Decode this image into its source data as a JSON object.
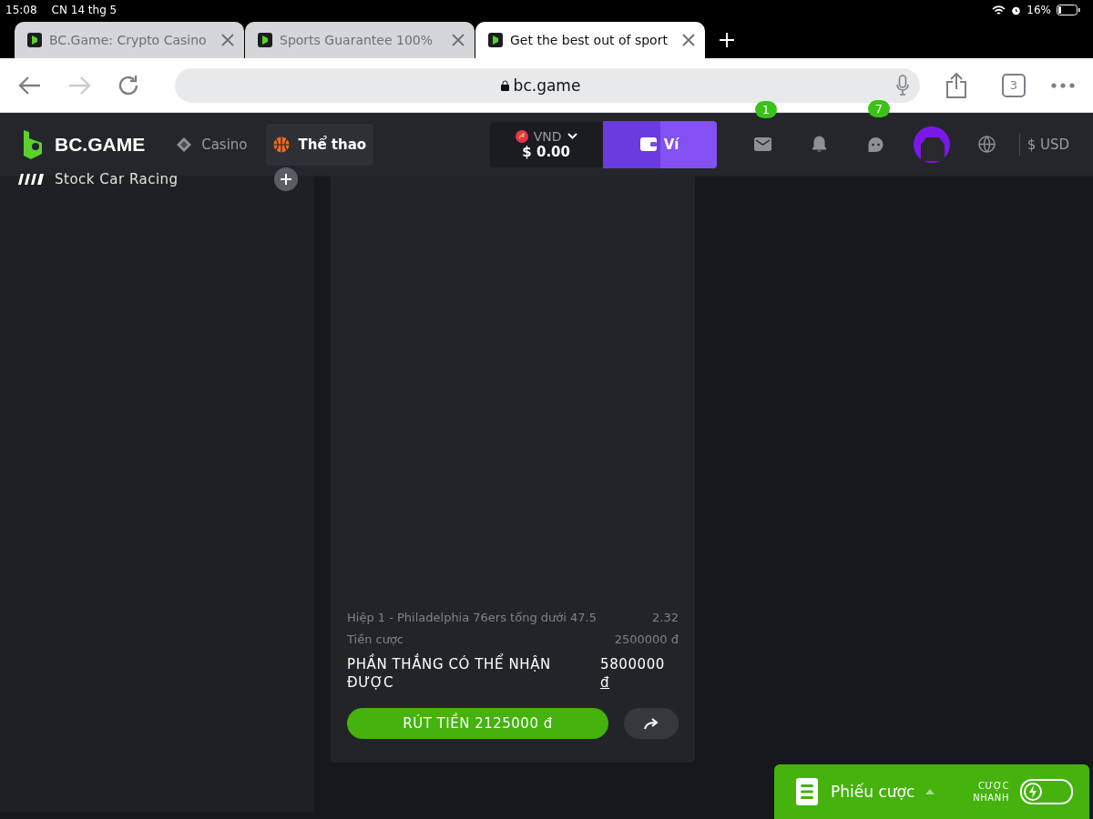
{
  "status_bar": {
    "time": "15:08",
    "date": "CN 14 thg 5",
    "battery": "16%"
  },
  "browser": {
    "tabs": [
      {
        "title": "BC.Game: Crypto Casino",
        "selected": false
      },
      {
        "title": "Sports Guarantee 100%",
        "selected": false
      },
      {
        "title": "Get the best out of sport",
        "selected": true
      }
    ],
    "url": "bc.game",
    "tab_count": "3"
  },
  "header": {
    "logo": "BC.GAME",
    "nav": [
      {
        "label": "Casino",
        "kind": "casino",
        "selected": false
      },
      {
        "label": "Thể thao",
        "kind": "sports",
        "selected": true
      }
    ],
    "balance": {
      "currency": "VND",
      "amount": "$ 0.00"
    },
    "wallet_button": "Ví",
    "icons": [
      {
        "kind": "mail",
        "badge": "1"
      },
      {
        "kind": "bell"
      },
      {
        "kind": "chat",
        "badge": "7"
      },
      {
        "kind": "avatar"
      },
      {
        "kind": "globe"
      }
    ],
    "currency": "$ USD"
  },
  "sidebar": {
    "items": [
      {
        "label": "Stock Car Racing"
      }
    ]
  },
  "bet_card": {
    "selection": "Hiệp 1 - Philadelphia 76ers tổng dưới 47.5",
    "odds": "2.32",
    "stake_label": "Tiền cược",
    "stake": "2500000 đ",
    "win_label": "PHẦN THẮNG CÓ THỂ NHẬN ĐƯỢC",
    "win_amount": "5800000",
    "win_currency": "đ",
    "cashout": "RÚT TIỀN 2125000 đ"
  },
  "betslip": {
    "label": "Phiếu cược",
    "quick_bet_label": [
      "CƯỢC",
      "NHANH"
    ],
    "quick_bet_on": false
  }
}
